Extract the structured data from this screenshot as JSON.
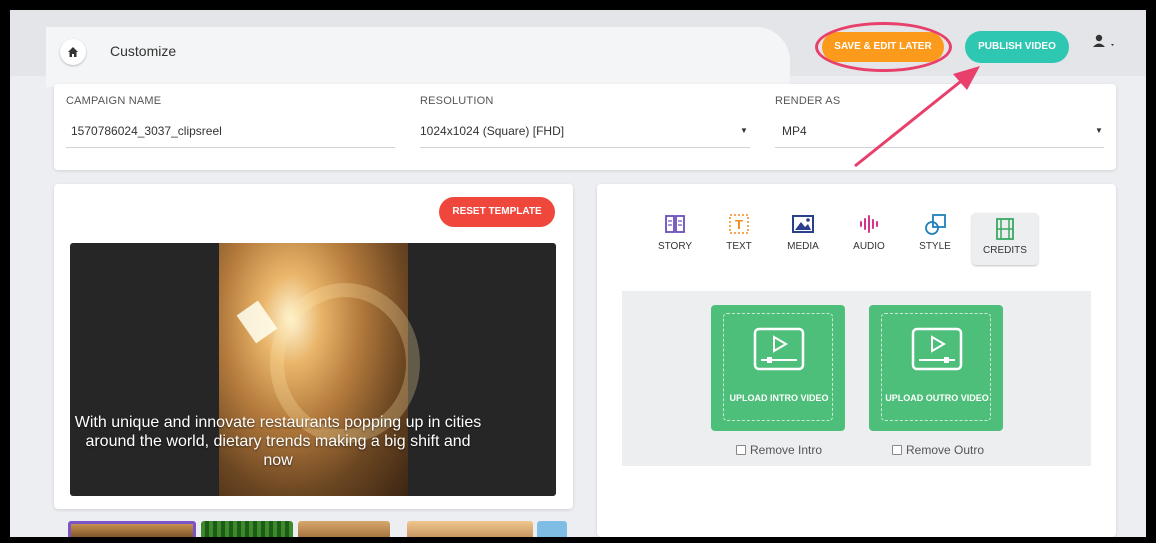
{
  "header": {
    "page_title": "Customize",
    "save_label": "SAVE & EDIT LATER",
    "publish_label": "PUBLISH VIDEO",
    "icons": {
      "home": "home-icon",
      "user": "user-icon",
      "dropdown": "chevron-down-icon"
    }
  },
  "settings": {
    "campaign_name": {
      "label": "CAMPAIGN NAME",
      "value": "1570786024_3037_clipsreel"
    },
    "resolution": {
      "label": "RESOLUTION",
      "value": "1024x1024 (Square) [FHD]"
    },
    "render_as": {
      "label": "RENDER AS",
      "value": "MP4"
    }
  },
  "preview": {
    "reset_label": "RESET TEMPLATE",
    "caption": "With unique and innovate restaurants popping up in cities around the world, dietary trends making a big shift and now"
  },
  "tabs": [
    {
      "label": "STORY",
      "icon": "book-icon",
      "color": "#6c4fbf"
    },
    {
      "label": "TEXT",
      "icon": "text-icon",
      "color": "#f08a1c"
    },
    {
      "label": "MEDIA",
      "icon": "image-icon",
      "color": "#2b3f8f"
    },
    {
      "label": "AUDIO",
      "icon": "audio-wave-icon",
      "color": "#d63384"
    },
    {
      "label": "STYLE",
      "icon": "shapes-icon",
      "color": "#1f7fbf"
    },
    {
      "label": "CREDITS",
      "icon": "film-icon",
      "color": "#3aa865"
    }
  ],
  "credits": {
    "intro": {
      "label": "UPLOAD INTRO VIDEO",
      "remove_label": "Remove Intro"
    },
    "outro": {
      "label": "UPLOAD OUTRO VIDEO",
      "remove_label": "Remove Outro"
    }
  },
  "colors": {
    "save": "#fb9a1b",
    "publish": "#2ec7b2",
    "reset": "#f0473d",
    "upload_card": "#4ebf7a",
    "annotation": "#e83f6b"
  }
}
